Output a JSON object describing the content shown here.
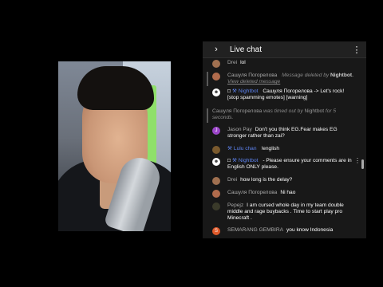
{
  "chat": {
    "title": "Live chat",
    "messages": [
      {
        "author": "Drei",
        "text": "lol"
      },
      {
        "author": "Сашуля Погорелова",
        "deleted_note": "Message deleted by",
        "deleted_by": "Nightbot",
        "view_link": "View deleted message"
      },
      {
        "author": "Nightbot",
        "text": "Сашуля Погорелова -> Let's rock! [stop spamming emotes] [warning]"
      },
      {
        "author": "Сашуля Погорелова",
        "note_mid": "was timed out by",
        "note_by": "Nightbot",
        "note_end": "for 5 seconds."
      },
      {
        "author": "Jason Pay",
        "text": "Don't you think EG.Fear makes EG stronger rather than zai?"
      },
      {
        "author": "Lulu chan",
        "text": "!english"
      },
      {
        "author": "Nightbot",
        "text": "- Please ensure your comments are in English ONLY please."
      },
      {
        "author": "Drei",
        "text": "how long is the delay?"
      },
      {
        "author": "Сашуля Погорелова",
        "text": "Ni hao"
      },
      {
        "author": "Pepejz",
        "text": "I am cursed whole day in my team double middle and rage buybacks . Time to start play pro Minecraft ."
      },
      {
        "author": "SEMARANG GEMBIRA",
        "text": "you know Indonesia"
      }
    ],
    "avatar_letters": {
      "jason": "J",
      "semarang": "S"
    }
  },
  "colors": {
    "moderator_blue": "#5e84f1",
    "panel_bg": "#181818",
    "header_bg": "#212121"
  },
  "icons": {
    "expand": "chevron-right-icon",
    "menu": "more-vertical-icon",
    "moderator": "wrench-icon",
    "verified": "shield-icon"
  }
}
